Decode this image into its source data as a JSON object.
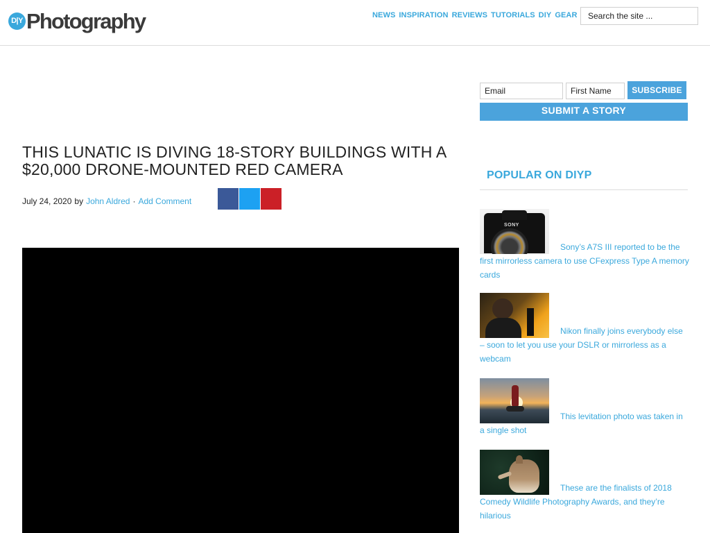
{
  "header": {
    "logo_badge": "D|Y",
    "logo_text": "Photography",
    "nav": [
      "NEWS",
      "INSPIRATION",
      "REVIEWS",
      "TUTORIALS",
      "DIY",
      "GEAR"
    ],
    "search_placeholder": "Search the site ..."
  },
  "article": {
    "title": "THIS LUNATIC IS DIVING 18-STORY BUILDINGS WITH A $20,000 DRONE-MOUNTED RED CAMERA",
    "date": "July 24, 2020",
    "by": "by",
    "author": "John Aldred",
    "separator": "·",
    "comment_link": "Add Comment"
  },
  "subscribe": {
    "email_placeholder": "Email",
    "name_placeholder": "First Name",
    "subscribe_label": "SUBSCRIBE",
    "submit_story_label": "SUBMIT A STORY"
  },
  "popular": {
    "title": "POPULAR ON DIYP",
    "posts": [
      {
        "caption": "Sony’s A7S III reported to be the first mirrorless camera to use CFexpress Type A memory cards",
        "thumb_brand": "SONY"
      },
      {
        "caption": "Nikon finally joins everybody else – soon to let you use your DSLR or mirrorless as a webcam"
      },
      {
        "caption": "This levitation photo was taken in a single shot"
      },
      {
        "caption": "These are the finalists of 2018 Comedy Wildlife Photography Awards, and they’re hilarious"
      }
    ]
  },
  "colors": {
    "accent": "#3aa8dc",
    "button": "#4ba3dc",
    "facebook": "#3b5998",
    "twitter": "#1da1f2",
    "pinterest": "#cb2027"
  }
}
